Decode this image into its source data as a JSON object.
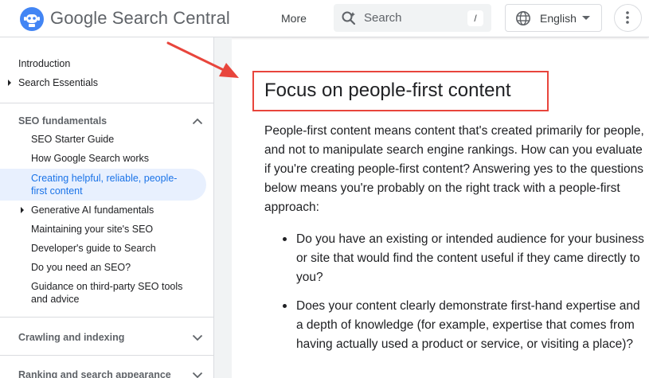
{
  "header": {
    "brand_google": "Google",
    "brand_rest": " Search Central",
    "more_label": "More",
    "search_placeholder": "Search",
    "search_shortcut": "/",
    "language_label": "English"
  },
  "sidebar": {
    "top_items": [
      {
        "label": "Introduction"
      },
      {
        "label": "Search Essentials"
      }
    ],
    "sections": [
      {
        "label": "SEO fundamentals",
        "expanded": true
      },
      {
        "label": "Crawling and indexing",
        "expanded": false
      },
      {
        "label": "Ranking and search appearance",
        "expanded": false
      }
    ],
    "seo_items": [
      {
        "label": "SEO Starter Guide"
      },
      {
        "label": "How Google Search works"
      },
      {
        "label": "Creating helpful, reliable, people-first content",
        "active": true
      },
      {
        "label": "Generative AI fundamentals"
      },
      {
        "label": "Maintaining your site's SEO"
      },
      {
        "label": "Developer's guide to Search"
      },
      {
        "label": "Do you need an SEO?"
      },
      {
        "label": "Guidance on third-party SEO tools and advice"
      }
    ]
  },
  "main": {
    "title": "Focus on people-first content",
    "intro": "People-first content means content that's created primarily for people, and not to manipulate search engine rankings. How can you evaluate if you're creating people-first content? Answering yes to the questions below means you're probably on the right track with a people-first approach:",
    "bullets": [
      "Do you have an existing or intended audience for your business or site that would find the content useful if they came directly to you?",
      "Does your content clearly demonstrate first-hand expertise and a depth of knowledge (for example, expertise that comes from having actually used a product or service, or visiting a place)?"
    ]
  },
  "colors": {
    "accent": "#1a73e8",
    "active_bg": "#e8f0fe",
    "annotation_red": "#e8453c"
  },
  "icons": [
    "robot-logo-icon",
    "search-icon",
    "globe-icon",
    "caret-down-icon",
    "more-vert-icon",
    "chevron-up-icon",
    "chevron-down-icon",
    "expand-triangle-icon",
    "annotation-arrow-icon"
  ]
}
